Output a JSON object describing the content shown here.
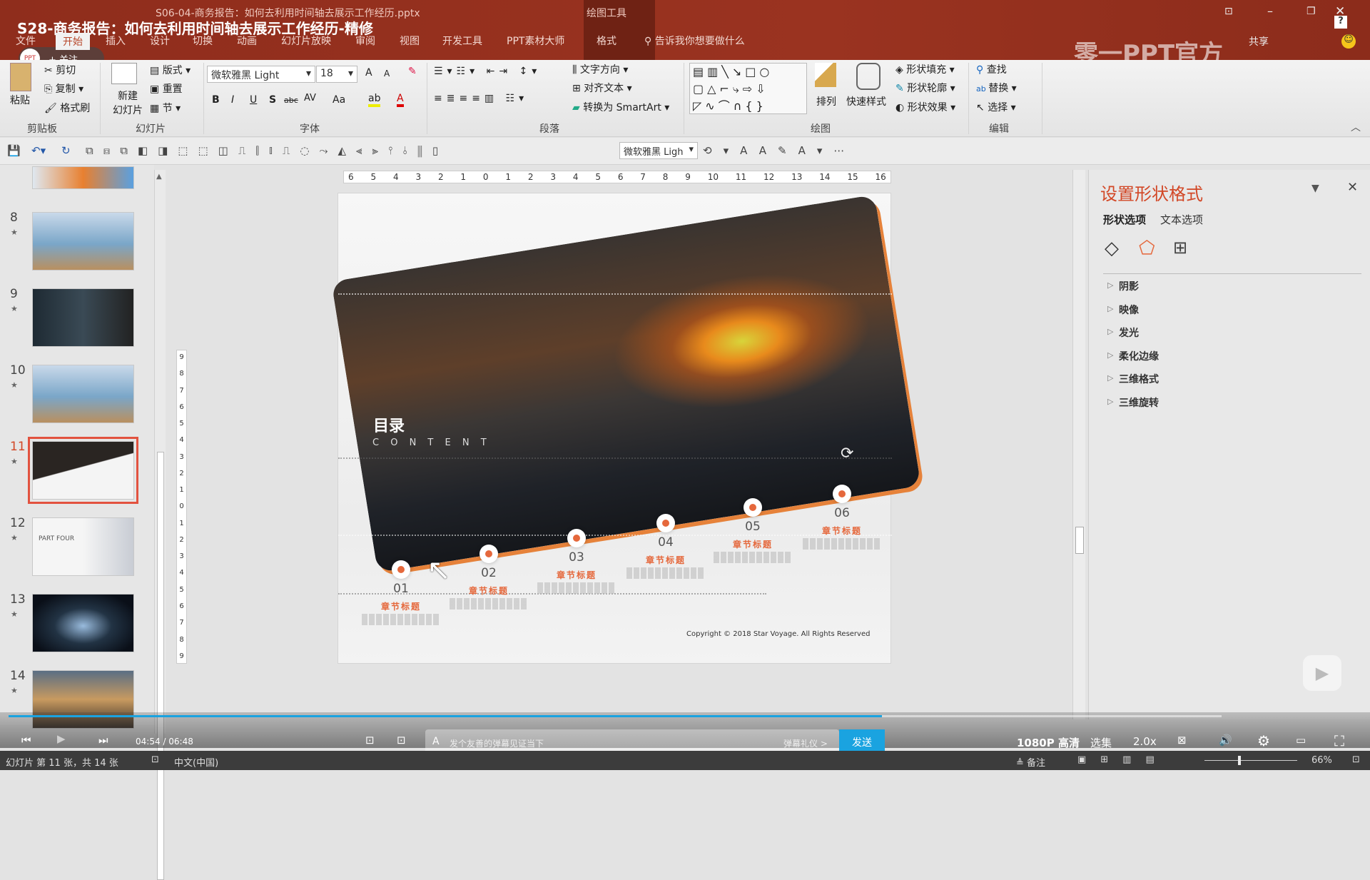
{
  "window": {
    "file_title": "S06-04-商务报告：如何去利用时间轴去展示工作经历.pptx",
    "video_title": "S28-商务报告：如何去利用时间轴去展示工作经历-精修",
    "context_tab": "绘图工具",
    "search_placeholder": "告诉我你想要做什么",
    "watermark": "零一PPT官方",
    "share": "共享",
    "follow": "+ 关注",
    "colors": {
      "title_bar": "#922f1e",
      "accent": "#d24726",
      "timeline": "#e5683c",
      "player_progress": "#1aa3e0"
    }
  },
  "tabs": [
    "文件",
    "开始",
    "插入",
    "设计",
    "切换",
    "动画",
    "幻灯片放映",
    "审阅",
    "视图",
    "开发工具",
    "PPT素材大师",
    "格式"
  ],
  "active_tab": "开始",
  "ribbon": {
    "clipboard": {
      "label": "剪贴板",
      "paste": "粘贴",
      "cut": "剪切",
      "copy": "复制",
      "format_painter": "格式刷"
    },
    "slides": {
      "label": "幻灯片",
      "new_slide": "新建",
      "new_slide2": "幻灯片",
      "layout": "版式",
      "reset": "重置",
      "section": "节"
    },
    "font": {
      "label": "字体",
      "font_name": "微软雅黑 Light",
      "font_size": "18",
      "bold": "B",
      "italic": "I",
      "underline": "U",
      "shadow": "S",
      "strike": "abc",
      "spacing": "AV",
      "case": "Aa",
      "grow": "A",
      "shrink": "A",
      "color": "A"
    },
    "paragraph": {
      "label": "段落",
      "text_direction": "文字方向",
      "align_text": "对齐文本",
      "smartart": "转换为 SmartArt"
    },
    "drawing": {
      "label": "绘图",
      "arrange": "排列",
      "quick_styles": "快速样式",
      "fill": "形状填充",
      "outline": "形状轮廓",
      "effects": "形状效果"
    },
    "editing": {
      "label": "编辑",
      "find": "查找",
      "replace": "替换",
      "select": "选择"
    }
  },
  "qat": {
    "font_name": "微软雅黑 Ligh"
  },
  "hruler": [
    "6",
    "5",
    "4",
    "3",
    "2",
    "1",
    "0",
    "1",
    "2",
    "3",
    "4",
    "5",
    "6",
    "7",
    "8",
    "9",
    "10",
    "11",
    "12",
    "13",
    "14",
    "15",
    "16"
  ],
  "vruler": [
    "9",
    "8",
    "7",
    "6",
    "5",
    "4",
    "3",
    "2",
    "1",
    "0",
    "1",
    "2",
    "3",
    "4",
    "5",
    "6",
    "7",
    "8",
    "9"
  ],
  "thumbnails": [
    {
      "num": "8",
      "star": "★"
    },
    {
      "num": "9",
      "star": "★"
    },
    {
      "num": "10",
      "star": "★"
    },
    {
      "num": "11",
      "star": "★",
      "selected": true
    },
    {
      "num": "12",
      "star": "★"
    },
    {
      "num": "13",
      "star": "★"
    },
    {
      "num": "14",
      "star": "★"
    }
  ],
  "thumb12_text": "PART FOUR",
  "slide": {
    "title": "目录",
    "subtitle": "C O N T E N T",
    "copyright": "Copyright © 2018 Star Voyage. All Rights Reserved",
    "timeline": [
      {
        "num": "01",
        "title": "章节标题"
      },
      {
        "num": "02",
        "title": "章节标题"
      },
      {
        "num": "03",
        "title": "章节标题"
      },
      {
        "num": "04",
        "title": "章节标题"
      },
      {
        "num": "05",
        "title": "章节标题"
      },
      {
        "num": "06",
        "title": "章节标题"
      }
    ]
  },
  "panel": {
    "title": "设置形状格式",
    "tabs": [
      "形状选项",
      "文本选项"
    ],
    "active_tab": "形状选项",
    "icons": [
      "fill-line-icon",
      "effects-icon",
      "size-properties-icon"
    ],
    "active_icon": "effects-icon",
    "items": [
      "阴影",
      "映像",
      "发光",
      "柔化边缘",
      "三维格式",
      "三维旋转"
    ]
  },
  "player": {
    "time": "04:54 / 06:48",
    "progress": 0.72,
    "danmaku_placeholder": "发个友善的弹幕见证当下",
    "etiquette": "弹幕礼仪 >",
    "send": "发送",
    "quality": "1080P 高清",
    "episodes": "选集",
    "speed": "2.0x"
  },
  "status": {
    "slide_info": "幻灯片 第 11 张，共 14 张",
    "language": "中文(中国)",
    "notes": "备注",
    "zoom": "66%",
    "zoom_level": 66
  }
}
